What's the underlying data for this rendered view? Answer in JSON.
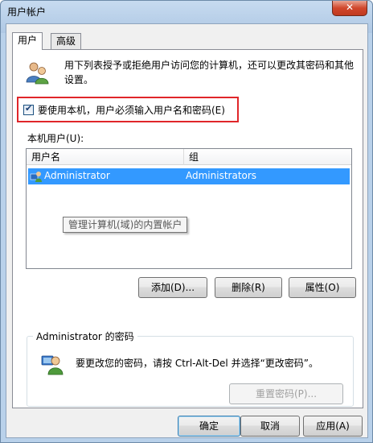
{
  "window": {
    "title": "用户帐户",
    "close_glyph": "✕"
  },
  "tabs": [
    {
      "label": "用户",
      "active": true
    },
    {
      "label": "高级",
      "active": false
    }
  ],
  "description": "用下列表授予或拒绝用户访问您的计算机，还可以更改其密码和其他设置。",
  "require_login_checkbox": {
    "label": "要使用本机，用户必须输入用户名和密码(E)",
    "checked": true,
    "check_glyph": "✔"
  },
  "local_users": {
    "label": "本机用户(U):",
    "columns": [
      "用户名",
      "组"
    ],
    "rows": [
      {
        "name": "Administrator",
        "group": "Administrators",
        "selected": true
      }
    ],
    "tooltip": "管理计算机(域)的内置帐户"
  },
  "user_buttons": {
    "add": "添加(D)...",
    "remove": "删除(R)",
    "properties": "属性(O)"
  },
  "password_group": {
    "title": "Administrator 的密码",
    "text": "要更改您的密码，请按 Ctrl-Alt-Del 并选择“更改密码”。",
    "reset_button": "重置密码(P)..."
  },
  "dialog_buttons": {
    "ok": "确定",
    "cancel": "取消",
    "apply": "应用(A)"
  },
  "colors": {
    "selection": "#3399ff",
    "highlight_box": "#e0262a",
    "close_button": "#d0472c"
  }
}
